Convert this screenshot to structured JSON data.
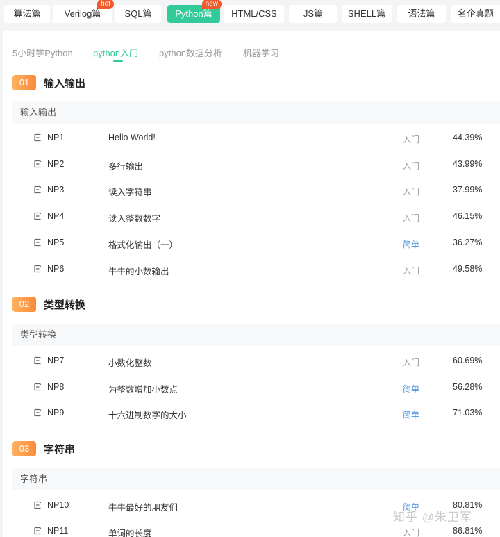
{
  "top_tabs": [
    {
      "label": "算法篇"
    },
    {
      "label": "Verilog篇",
      "badge": "hot"
    },
    {
      "label": "SQL篇"
    },
    {
      "label": "Python篇",
      "badge": "new",
      "active": true
    },
    {
      "label": "HTML/CSS"
    },
    {
      "label": "JS篇"
    },
    {
      "label": "SHELL篇"
    },
    {
      "label": "语法篇"
    },
    {
      "label": "名企真题"
    }
  ],
  "sub_tabs": [
    {
      "label": "5小时学Python"
    },
    {
      "label": "python入门",
      "active": true
    },
    {
      "label": "python数据分析"
    },
    {
      "label": "机器学习"
    }
  ],
  "sections": [
    {
      "num": "01",
      "title": "输入输出",
      "group": "输入输出",
      "items": [
        {
          "id": "NP1",
          "title": "Hello World!",
          "level": "入门",
          "rate": "44.39%"
        },
        {
          "id": "NP2",
          "title": "多行输出",
          "level": "入门",
          "rate": "43.99%"
        },
        {
          "id": "NP3",
          "title": "读入字符串",
          "level": "入门",
          "rate": "37.99%"
        },
        {
          "id": "NP4",
          "title": "读入整数数字",
          "level": "入门",
          "rate": "46.15%"
        },
        {
          "id": "NP5",
          "title": "格式化输出（一）",
          "level": "简单",
          "rate": "36.27%"
        },
        {
          "id": "NP6",
          "title": "牛牛的小数输出",
          "level": "入门",
          "rate": "49.58%"
        }
      ]
    },
    {
      "num": "02",
      "title": "类型转换",
      "group": "类型转换",
      "items": [
        {
          "id": "NP7",
          "title": "小数化整数",
          "level": "入门",
          "rate": "60.69%"
        },
        {
          "id": "NP8",
          "title": "为整数增加小数点",
          "level": "简单",
          "rate": "56.28%"
        },
        {
          "id": "NP9",
          "title": "十六进制数字的大小",
          "level": "简单",
          "rate": "71.03%"
        }
      ]
    },
    {
      "num": "03",
      "title": "字符串",
      "group": "字符串",
      "items": [
        {
          "id": "NP10",
          "title": "牛牛最好的朋友们",
          "level": "简单",
          "rate": "80.81%"
        },
        {
          "id": "NP11",
          "title": "单词的长度",
          "level": "入门",
          "rate": "86.81%"
        }
      ]
    }
  ],
  "watermark": "知乎 @朱卫军",
  "colors": {
    "accent": "#32ca99",
    "badge": "#ef5b2c",
    "easy": "#4a90e2",
    "section_badge": "#fb8a3c"
  }
}
